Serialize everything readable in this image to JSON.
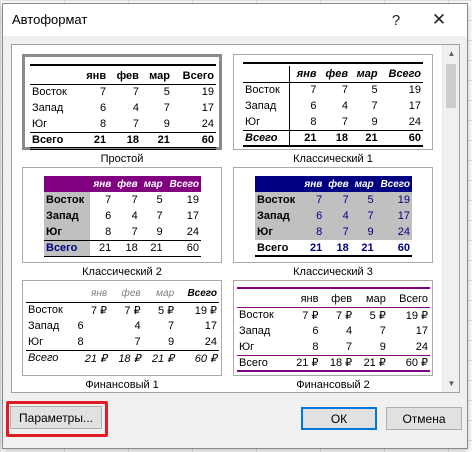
{
  "dialog": {
    "title": "Автоформат",
    "help_glyph": "?",
    "close_glyph": "✕"
  },
  "formats": [
    {
      "name": "Простой",
      "header": [
        "",
        "янв",
        "фев",
        "мар",
        "Всего"
      ],
      "rows": [
        [
          "Восток",
          "7",
          "7",
          "5",
          "19"
        ],
        [
          "Запад",
          "6",
          "4",
          "7",
          "17"
        ],
        [
          "Юг",
          "8",
          "7",
          "9",
          "24"
        ],
        [
          "Всего",
          "21",
          "18",
          "21",
          "60"
        ]
      ]
    },
    {
      "name": "Классический 1",
      "header": [
        "",
        "янв",
        "фев",
        "мар",
        "Всего"
      ],
      "rows": [
        [
          "Восток",
          "7",
          "7",
          "5",
          "19"
        ],
        [
          "Запад",
          "6",
          "4",
          "7",
          "17"
        ],
        [
          "Юг",
          "8",
          "7",
          "9",
          "24"
        ],
        [
          "Всего",
          "21",
          "18",
          "21",
          "60"
        ]
      ]
    },
    {
      "name": "Классический 2",
      "header": [
        "",
        "янв",
        "фев",
        "мар",
        "Всего"
      ],
      "rows": [
        [
          "Восток",
          "7",
          "7",
          "5",
          "19"
        ],
        [
          "Запад",
          "6",
          "4",
          "7",
          "17"
        ],
        [
          "Юг",
          "8",
          "7",
          "9",
          "24"
        ],
        [
          "Всего",
          "21",
          "18",
          "21",
          "60"
        ]
      ]
    },
    {
      "name": "Классический 3",
      "header": [
        "",
        "янв",
        "фев",
        "мар",
        "Всего"
      ],
      "rows": [
        [
          "Восток",
          "7",
          "7",
          "5",
          "19"
        ],
        [
          "Запад",
          "6",
          "4",
          "7",
          "17"
        ],
        [
          "Юг",
          "8",
          "7",
          "9",
          "24"
        ],
        [
          "Всего",
          "21",
          "18",
          "21",
          "60"
        ]
      ]
    },
    {
      "name": "Финансовый 1",
      "header": [
        "",
        "янв",
        "фев",
        "мар",
        "Всего"
      ],
      "rows": [
        [
          "Восток",
          "7 ₽",
          "7 ₽",
          "5 ₽",
          "19 ₽"
        ],
        [
          "Запад",
          "6",
          "4",
          "7",
          "17"
        ],
        [
          "Юг",
          "8",
          "7",
          "9",
          "24"
        ],
        [
          "Всего",
          "21 ₽",
          "18 ₽",
          "21 ₽",
          "60 ₽"
        ]
      ]
    },
    {
      "name": "Финансовый 2",
      "header": [
        "",
        "янв",
        "фев",
        "мар",
        "Всего"
      ],
      "rows": [
        [
          "Восток",
          "7 ₽",
          "7 ₽",
          "5 ₽",
          "19 ₽"
        ],
        [
          "Запад",
          "6",
          "4",
          "7",
          "17"
        ],
        [
          "Юг",
          "8",
          "7",
          "9",
          "24"
        ],
        [
          "Всего",
          "21 ₽",
          "18 ₽",
          "21 ₽",
          "60 ₽"
        ]
      ]
    }
  ],
  "buttons": {
    "params": "Параметры...",
    "ok": "ОК",
    "cancel": "Отмена"
  },
  "colors": {
    "purple": "#800080",
    "navy": "#000080",
    "gray_fill": "#c0c0c0",
    "highlight_red": "#e01b24",
    "default_button_border": "#0078d7"
  },
  "icons": {
    "scroll_up": "▲",
    "scroll_down": "▼"
  }
}
